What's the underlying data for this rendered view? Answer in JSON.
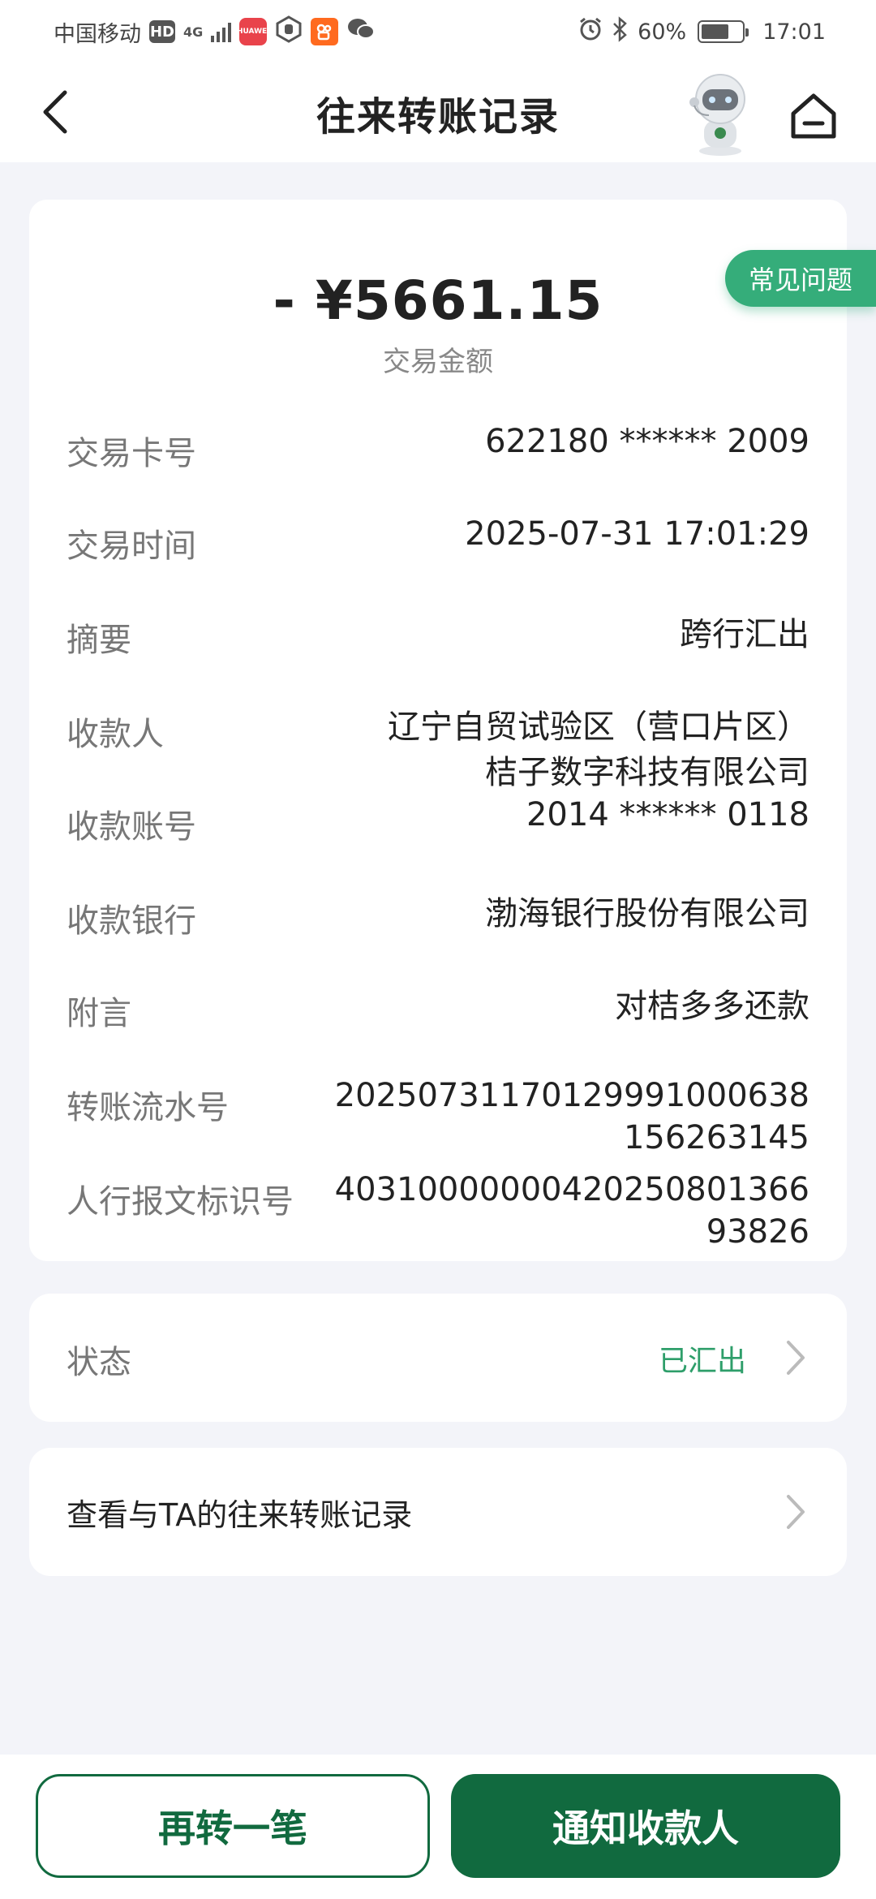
{
  "status_bar": {
    "carrier": "中国移动",
    "hd": "HD",
    "network": "4G",
    "battery_percent": "60%",
    "time": "17:01",
    "icons": [
      "hd-icon",
      "signal-icon",
      "huawei-app-icon",
      "hand-icon",
      "kuaishou-icon",
      "wechat-icon",
      "alarm-icon",
      "bluetooth-icon",
      "battery-icon"
    ]
  },
  "header": {
    "title": "往来转账记录",
    "back_icon": "chevron-left-icon",
    "assistant_icon": "robot-assistant-icon",
    "home_icon": "home-icon"
  },
  "faq": {
    "label": "常见问题"
  },
  "transaction": {
    "amount": "- ¥5661.15",
    "amount_label": "交易金额",
    "rows": [
      {
        "label": "交易卡号",
        "value": "622180 ****** 2009"
      },
      {
        "label": "交易时间",
        "value": "2025-07-31 17:01:29"
      },
      {
        "label": "摘要",
        "value": "跨行汇出"
      },
      {
        "label": "收款人",
        "value_lines": [
          "辽宁自贸试验区（营口片区）",
          "桔子数字科技有限公司"
        ]
      },
      {
        "label": "收款账号",
        "value": "2014 ****** 0118"
      },
      {
        "label": "收款银行",
        "value": "渤海银行股份有限公司"
      },
      {
        "label": "附言",
        "value": "对桔多多还款"
      },
      {
        "label": "转账流水号",
        "value_lines": [
          "20250731170129991000638",
          "156263145"
        ]
      },
      {
        "label": "人行报文标识号",
        "value_lines": [
          "40310000000420250801366",
          "93826"
        ]
      }
    ]
  },
  "status": {
    "label": "状态",
    "value": "已汇出",
    "status_color": "#2e9e6a"
  },
  "history": {
    "label": "查看与TA的往来转账记录"
  },
  "actions": {
    "again": "再转一笔",
    "notify": "通知收款人"
  },
  "colors": {
    "brand_green": "#116a3f",
    "accent_green": "#35ad7a",
    "background": "#f3f4f9"
  }
}
